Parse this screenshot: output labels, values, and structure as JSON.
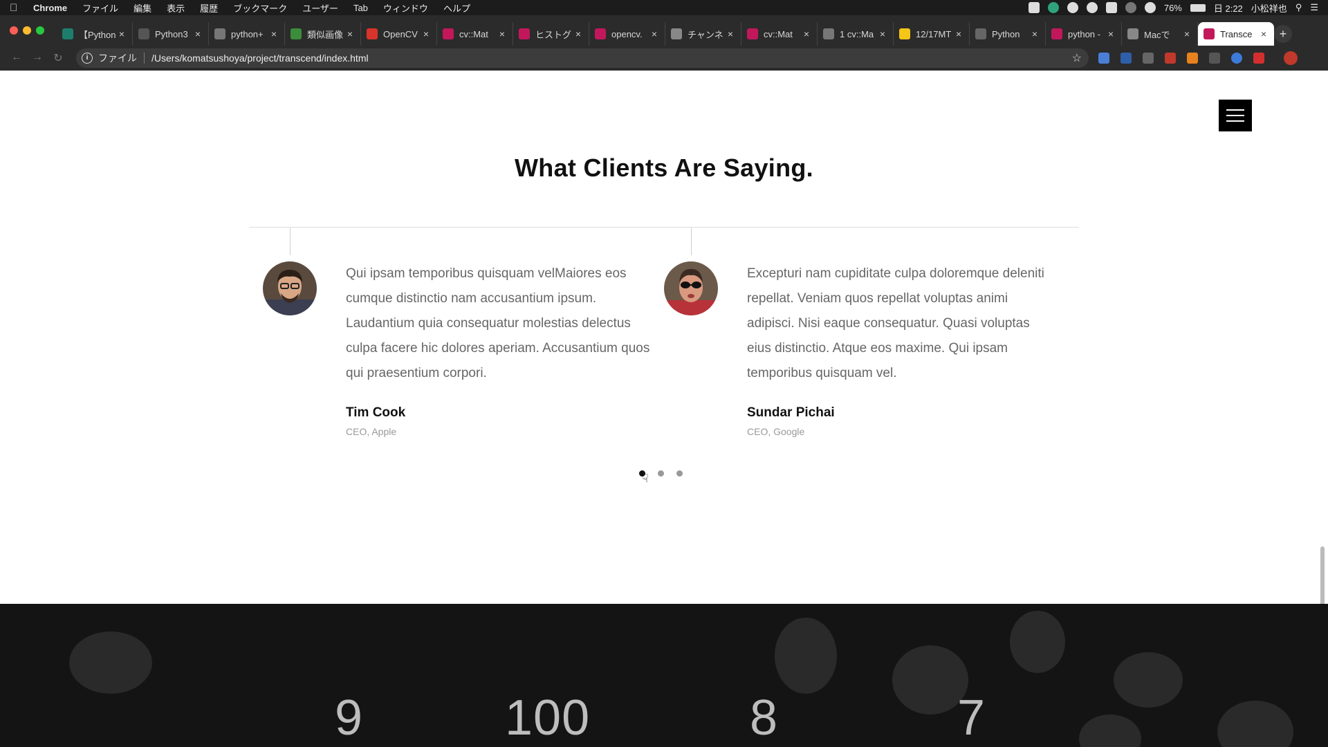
{
  "menubar": {
    "app": "Chrome",
    "items": [
      "ファイル",
      "編集",
      "表示",
      "履歴",
      "ブックマーク",
      "ユーザー",
      "Tab",
      "ウィンドウ",
      "ヘルプ"
    ],
    "battery": "76%",
    "clock": "日 2:22",
    "user": "小松祥也"
  },
  "tabs": [
    {
      "title": "【Python",
      "color": "#1e7e6e"
    },
    {
      "title": "Python3",
      "color": "#555555"
    },
    {
      "title": "python+",
      "color": "#777777"
    },
    {
      "title": "類似画像",
      "color": "#3b8c3b"
    },
    {
      "title": "OpenCV",
      "color": "#d9342b"
    },
    {
      "title": "cv::Mat",
      "color": "#c2185b"
    },
    {
      "title": "ヒストグ",
      "color": "#c2185b"
    },
    {
      "title": "opencv.",
      "color": "#c2185b"
    },
    {
      "title": "チャンネ",
      "color": "#888888"
    },
    {
      "title": "cv::Mat",
      "color": "#c2185b"
    },
    {
      "title": "1 cv::Ma",
      "color": "#777777"
    },
    {
      "title": "12/17MT",
      "color": "#f5c518"
    },
    {
      "title": "Python",
      "color": "#666666"
    },
    {
      "title": "python -",
      "color": "#c2185b"
    },
    {
      "title": "Macで",
      "color": "#888888"
    },
    {
      "title": "Transce",
      "color": "#c2185b",
      "active": true
    }
  ],
  "address": {
    "scheme_label": "ファイル",
    "url": "/Users/komatsushoya/project/transcend/index.html"
  },
  "page": {
    "title": "What Clients Are Saying.",
    "testimonials": [
      {
        "quote": "Qui ipsam temporibus quisquam velMaiores eos cumque distinctio nam accusantium ipsum. Laudantium quia consequatur molestias delectus culpa facere hic dolores aperiam. Accusantium quos qui praesentium corpori.",
        "name": "Tim Cook",
        "role": "CEO, Apple"
      },
      {
        "quote": "Excepturi nam cupiditate culpa doloremque deleniti repellat. Veniam quos repellat voluptas animi adipisci. Nisi eaque consequatur. Quasi voluptas eius distinctio. Atque eos maxime. Qui ipsam temporibus quisquam vel.",
        "name": "Sundar Pichai",
        "role": "CEO, Google"
      }
    ],
    "slider": {
      "count": 3,
      "active": 1
    },
    "stats": [
      "9",
      "100",
      "8",
      "7"
    ]
  },
  "colors": {
    "menubar": "#1c1c1c",
    "chrome_dark": "#2b2b2b",
    "stats_bg": "#141414"
  }
}
